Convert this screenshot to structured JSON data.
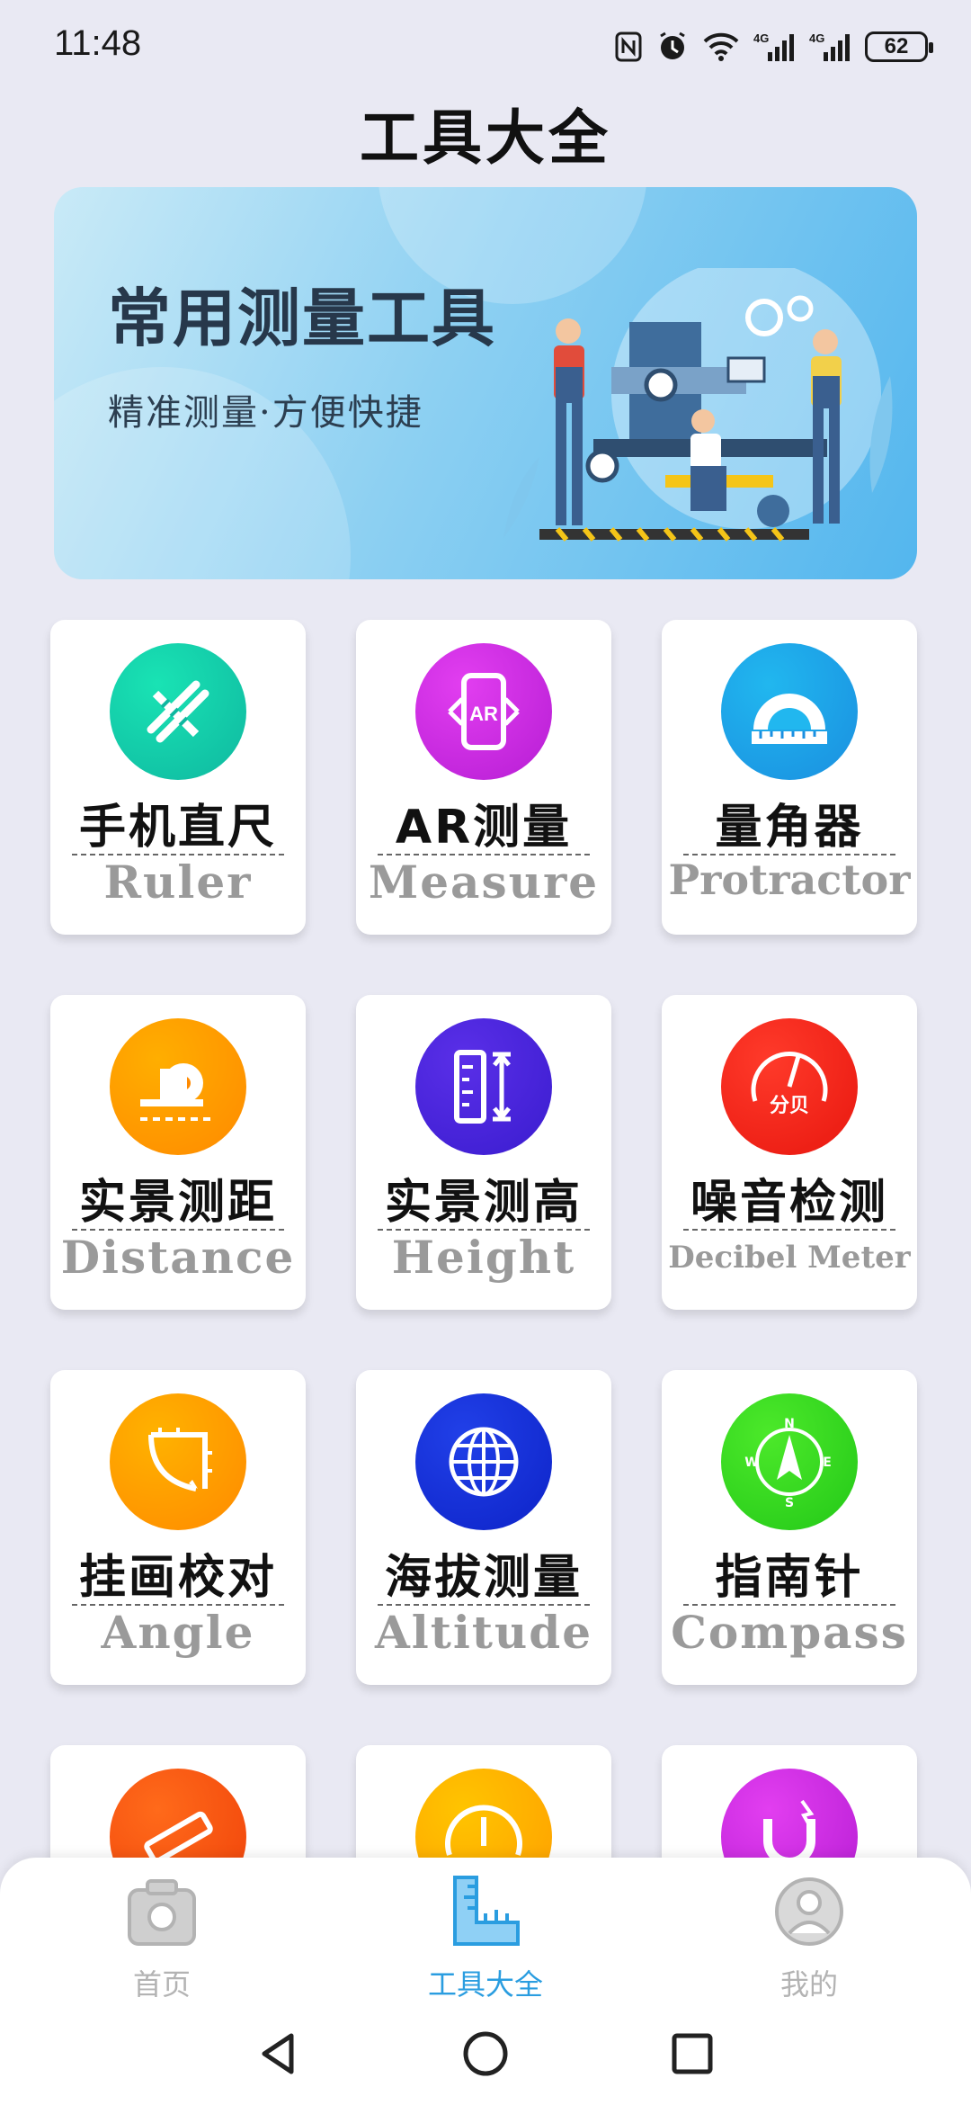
{
  "status": {
    "time": "11:48",
    "battery": "62",
    "icons": [
      "nfc-icon",
      "alarm-icon",
      "wifi-icon",
      "signal-4g-icon",
      "signal-4g-icon",
      "battery-icon"
    ],
    "net1": "4G",
    "net2": "4G"
  },
  "page_title": "工具大全",
  "banner": {
    "title": "常用测量工具",
    "subtitle": "精准测量·方便快捷"
  },
  "tools": [
    {
      "cn": "手机直尺",
      "en": "Ruler",
      "color1": "#19e3b4",
      "color2": "#0fb8a0",
      "icon": "ruler-pencil-icon"
    },
    {
      "cn": "AR测量",
      "en": "Measure",
      "color1": "#e23ef0",
      "color2": "#b61dd4",
      "icon": "ar-phone-icon"
    },
    {
      "cn": "量角器",
      "en": "Protractor",
      "color1": "#21b7ef",
      "color2": "#1a8fe0",
      "icon": "protractor-icon"
    },
    {
      "cn": "实景测距",
      "en": "Distance",
      "color1": "#ffae00",
      "color2": "#ff8a00",
      "icon": "tape-measure-icon"
    },
    {
      "cn": "实景测高",
      "en": "Height",
      "color1": "#5a2fe8",
      "color2": "#3a1ccf",
      "icon": "height-icon"
    },
    {
      "cn": "噪音检测",
      "en": "Decibel Meter",
      "color1": "#ff3a2a",
      "color2": "#e8170f",
      "icon": "decibel-gauge-icon"
    },
    {
      "cn": "挂画校对",
      "en": "Angle",
      "color1": "#ffb200",
      "color2": "#ff8a00",
      "icon": "angle-icon"
    },
    {
      "cn": "海拔测量",
      "en": "Altitude",
      "color1": "#2140e8",
      "color2": "#0d23c8",
      "icon": "globe-icon"
    },
    {
      "cn": "指南针",
      "en": "Compass",
      "color1": "#4ce92a",
      "color2": "#23c818",
      "icon": "compass-icon"
    },
    {
      "cn": "",
      "en": "",
      "color1": "#ff6a1a",
      "color2": "#f0420a",
      "icon": "level-icon"
    },
    {
      "cn": "",
      "en": "",
      "color1": "#ffc400",
      "color2": "#ff9e00",
      "icon": "speedometer-icon"
    },
    {
      "cn": "",
      "en": "",
      "color1": "#e23ef0",
      "color2": "#b61dd4",
      "icon": "magnet-icon"
    }
  ],
  "nav": {
    "home": "首页",
    "tools": "工具大全",
    "mine": "我的",
    "active_color": "#2a9de0",
    "inactive_color": "#b3b3b3"
  }
}
